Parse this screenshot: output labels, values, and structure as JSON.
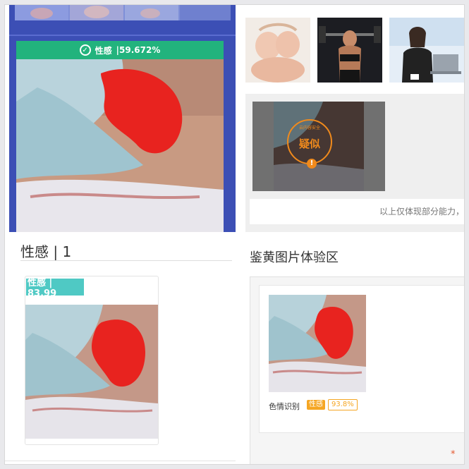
{
  "result_panel": {
    "label": "性感",
    "separator": "|",
    "score": "59.672%"
  },
  "category_section": {
    "title": "性感 | 1",
    "card_badge": "性感 | 83.99"
  },
  "sample_images": [
    "baby-twins-photo",
    "fitness-woman-photo",
    "businesswoman-laptop-photo"
  ],
  "suspect_stamp": {
    "arc_text": "云内容安全",
    "main_text": "疑似",
    "alert_glyph": "!"
  },
  "capability_note": "以上仅体现部分能力，",
  "experience_area": {
    "title": "鉴黄图片体验区",
    "result_label": "色情识别",
    "tag": "性感",
    "score": "93.8%",
    "required_mark": "*"
  },
  "colors": {
    "banner_green": "#22b37d",
    "badge_teal": "#4fc9c4",
    "panel_blue": "#3c4fb5",
    "stamp_orange": "#f08a1c",
    "tag_orange": "#f5a623",
    "censor_red": "#e8231f"
  }
}
